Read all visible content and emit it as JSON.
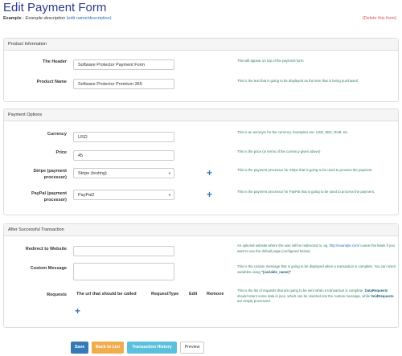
{
  "header": {
    "title": "Edit Payment Form",
    "form_name": "Example",
    "form_description": "Example description",
    "edit_link": "(edit name/description)",
    "delete_link": "(Delete this form)"
  },
  "product_info": {
    "heading": "Product Information",
    "header_label": "The Header",
    "header_value": "Software Protector Payment Form",
    "header_help": "This will appear on top of the payment form.",
    "product_label": "Product Name",
    "product_value": "Software Protector Premium 365",
    "product_help": "This is the text that is going to be displayed as the item that is being purchased"
  },
  "payment_options": {
    "heading": "Payment Options",
    "currency_label": "Currency",
    "currency_value": "USD",
    "currency_help": "This is an acronym for the currency. Examples are: USD, SEK, RUB, etc.",
    "price_label": "Price",
    "price_value": "45",
    "price_help": "This is the price (in terms of the currency given above)",
    "stripe_label_1": "Stripe (payment",
    "stripe_label_2": "processor)",
    "stripe_value": "Stripe (testing)",
    "stripe_help": "This is the payment processor for Stripe that is going to be used to process the payment.",
    "paypal_label_1": "PayPal (payment",
    "paypal_label_2": "processor)",
    "paypal_value": "PayPal2",
    "paypal_help": "This is the payment processor for PayPal that is going to be used to process the payment."
  },
  "after_transaction": {
    "heading": "After Successful Transaction",
    "redirect_label": "Redirect to Website",
    "redirect_value": "",
    "redirect_help_1": "An optional website where the user will be redirected to, eg.",
    "redirect_help_link": "http://example.com/",
    "redirect_help_2": "Leave this blank if you want to use the default page (configured below).",
    "message_label": "Custom Message",
    "message_value": "",
    "message_help_1": "This is the custom message that is going to be displayed when a transaction is complete. You can insert variables using",
    "message_help_var": "\"{variable_name}\"",
    "requests_label": "Requests",
    "col_url": "The url that should be called",
    "col_type": "RequestType",
    "col_edit": "Edit",
    "col_remove": "Remove",
    "requests_help_1": "This is the list of requests that are going to be sent when a transaction is complete.",
    "requests_help_data": "DataRequests",
    "requests_help_2": "should return some data in json, which can be inserted into the custom message, while",
    "requests_help_void": "VoidRequests",
    "requests_help_3": "are simply processed."
  },
  "buttons": {
    "save": "Save",
    "back": "Back to List",
    "history": "Transaction History",
    "preview": "Preview"
  },
  "colors": {
    "save": "#337ab7",
    "back": "#f0ad4e",
    "history": "#5bc0de",
    "title": "#2b3990"
  }
}
